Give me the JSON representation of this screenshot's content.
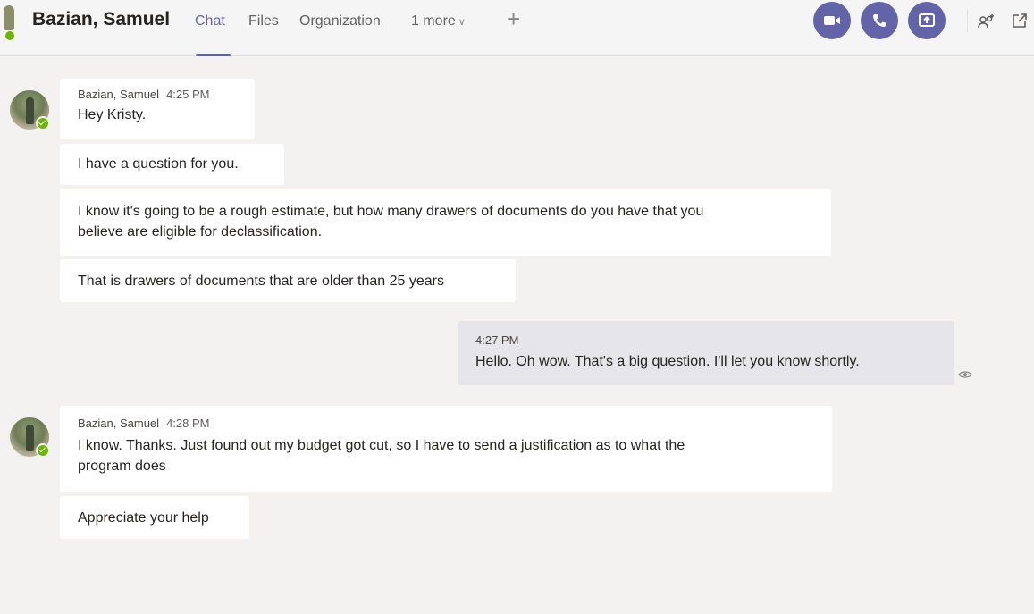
{
  "header": {
    "title": "Bazian, Samuel",
    "tabs": [
      {
        "label": "Chat",
        "active": true
      },
      {
        "label": "Files",
        "active": false
      },
      {
        "label": "Organization",
        "active": false
      }
    ],
    "more_label": "1 more",
    "add_tab_label": "+",
    "accent_color": "#6264a7",
    "presence_color": "#6bb700",
    "actions": [
      "video-call-icon",
      "audio-call-icon",
      "share-screen-icon",
      "add-people-icon",
      "pop-out-icon"
    ]
  },
  "messages": [
    {
      "sender": "Bazian, Samuel",
      "time": "4:25 PM",
      "lines": [
        "Hey Kristy."
      ]
    },
    {
      "lines": [
        "I have a question for you."
      ]
    },
    {
      "lines": [
        "I know it's going to be a rough estimate, but how many drawers of documents do you have that you",
        "believe are eligible for declassification."
      ]
    },
    {
      "lines": [
        "That is drawers of documents that are older than 25 years"
      ]
    },
    {
      "time": "4:27 PM",
      "lines": [
        "Hello.  Oh wow.  That's a big question.  I'll let you know shortly."
      ],
      "from_me": true
    },
    {
      "sender": "Bazian, Samuel",
      "time": "4:28 PM",
      "lines": [
        "I know. Thanks. Just found out my budget got cut, so I have to send a justification as to what the",
        "program does"
      ]
    },
    {
      "lines": [
        "Appreciate your help"
      ]
    }
  ]
}
